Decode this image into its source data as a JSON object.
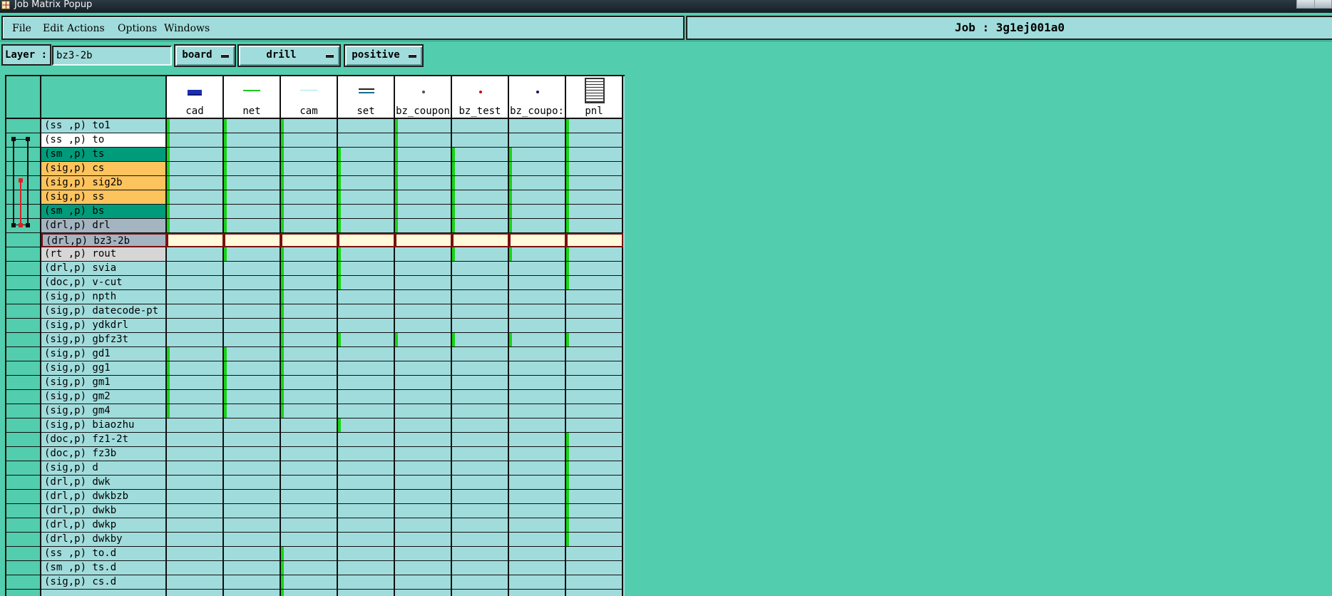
{
  "window": {
    "title": "Job Matrix Popup"
  },
  "menu": [
    "File",
    "Edit",
    "Actions",
    "Options",
    "Windows"
  ],
  "job": {
    "label": "Job : 3g1ej001a0"
  },
  "layer_bar": {
    "label": "Layer :",
    "value": "bz3-2b",
    "context": "board",
    "type": "drill",
    "polarity": "positive"
  },
  "steps": [
    {
      "label": "cad",
      "icon": "cad-step-icon"
    },
    {
      "label": "net",
      "icon": "net-step-icon"
    },
    {
      "label": "cam",
      "icon": "cam-step-icon"
    },
    {
      "label": "set",
      "icon": "set-step-icon"
    },
    {
      "label": "bz_coupon",
      "icon": "coupon-dot-icon"
    },
    {
      "label": "bz_test",
      "icon": "test-dot-icon"
    },
    {
      "label": "bz_coupo:",
      "icon": "coupon-dot-icon"
    },
    {
      "label": "pnl",
      "icon": "panel-step-icon"
    }
  ],
  "colors": {
    "board_bg": "#52cdad",
    "cell_bg": "#a1dcdc",
    "step_included": "#19d419",
    "silk_screen": "#ffffff",
    "solder_mask": "#009b7a",
    "signal": "#fdc35d",
    "drill": "#a4b4c0",
    "rout": "#d6d6d6",
    "selected_cell": "#fffad9"
  },
  "layers": [
    {
      "name": "(ss ,p) to1",
      "color": "#a1dcdc",
      "on": [
        0,
        1,
        2,
        4,
        7
      ]
    },
    {
      "name": "(ss ,p) to",
      "color": "#ffffff",
      "on": [
        0,
        1,
        2,
        4,
        7
      ]
    },
    {
      "name": "(sm ,p) ts",
      "color": "#009b7a",
      "on": [
        0,
        1,
        2,
        3,
        4,
        5,
        6,
        7
      ]
    },
    {
      "name": "(sig,p) cs",
      "color": "#fdc35d",
      "on": [
        0,
        1,
        2,
        3,
        4,
        5,
        6,
        7
      ]
    },
    {
      "name": "(sig,p) sig2b",
      "color": "#fdc35d",
      "on": [
        0,
        1,
        2,
        3,
        4,
        5,
        6,
        7
      ]
    },
    {
      "name": "(sig,p) ss",
      "color": "#fdc35d",
      "on": [
        0,
        1,
        2,
        3,
        4,
        5,
        6,
        7
      ]
    },
    {
      "name": "(sm ,p) bs",
      "color": "#009b7a",
      "on": [
        0,
        1,
        2,
        3,
        4,
        5,
        6,
        7
      ]
    },
    {
      "name": "(drl,p) drl",
      "color": "#a4b4c0",
      "on": [
        0,
        1,
        2,
        3,
        4,
        5,
        6,
        7
      ]
    },
    {
      "name": "(drl,p) bz3-2b",
      "color": "#a4b4c0",
      "on": [],
      "selected": true
    },
    {
      "name": "(rt ,p) rout",
      "color": "#d6d6d6",
      "on": [
        1,
        2,
        3,
        5,
        6,
        7
      ]
    },
    {
      "name": "(drl,p) svia",
      "color": "#a1dcdc",
      "on": [
        2,
        3,
        7
      ]
    },
    {
      "name": "(doc,p) v-cut",
      "color": "#a1dcdc",
      "on": [
        2,
        3,
        7
      ]
    },
    {
      "name": "(sig,p) npth",
      "color": "#a1dcdc",
      "on": [
        2
      ]
    },
    {
      "name": "(sig,p) datecode-pt",
      "color": "#a1dcdc",
      "on": [
        2
      ]
    },
    {
      "name": "(sig,p) ydkdrl",
      "color": "#a1dcdc",
      "on": [
        2
      ]
    },
    {
      "name": "(sig,p) gbfz3t",
      "color": "#a1dcdc",
      "on": [
        2,
        3,
        4,
        5,
        6,
        7
      ]
    },
    {
      "name": "(sig,p) gd1",
      "color": "#a1dcdc",
      "on": [
        0,
        1,
        2
      ]
    },
    {
      "name": "(sig,p) gg1",
      "color": "#a1dcdc",
      "on": [
        0,
        1,
        2
      ]
    },
    {
      "name": "(sig,p) gm1",
      "color": "#a1dcdc",
      "on": [
        0,
        1,
        2
      ]
    },
    {
      "name": "(sig,p) gm2",
      "color": "#a1dcdc",
      "on": [
        0,
        1,
        2
      ]
    },
    {
      "name": "(sig,p) gm4",
      "color": "#a1dcdc",
      "on": [
        0,
        1,
        2
      ]
    },
    {
      "name": "(sig,p) biaozhu",
      "color": "#a1dcdc",
      "on": [
        3
      ]
    },
    {
      "name": "(doc,p) fz1-2t",
      "color": "#a1dcdc",
      "on": [
        7
      ]
    },
    {
      "name": "(doc,p) fz3b",
      "color": "#a1dcdc",
      "on": [
        7
      ]
    },
    {
      "name": "(sig,p) d",
      "color": "#a1dcdc",
      "on": [
        7
      ]
    },
    {
      "name": "(drl,p) dwk",
      "color": "#a1dcdc",
      "on": [
        7
      ]
    },
    {
      "name": "(drl,p) dwkbzb",
      "color": "#a1dcdc",
      "on": [
        7
      ]
    },
    {
      "name": "(drl,p) dwkb",
      "color": "#a1dcdc",
      "on": [
        7
      ]
    },
    {
      "name": "(drl,p) dwkp",
      "color": "#a1dcdc",
      "on": [
        7
      ]
    },
    {
      "name": "(drl,p) dwkby",
      "color": "#a1dcdc",
      "on": [
        7
      ]
    },
    {
      "name": "(ss ,p) to.d",
      "color": "#a1dcdc",
      "on": [
        2
      ]
    },
    {
      "name": "(sm ,p) ts.d",
      "color": "#a1dcdc",
      "on": [
        2
      ]
    },
    {
      "name": "(sig,p) cs.d",
      "color": "#a1dcdc",
      "on": [
        2
      ]
    },
    {
      "name": "",
      "color": "#a1dcdc",
      "on": [
        2
      ]
    }
  ]
}
